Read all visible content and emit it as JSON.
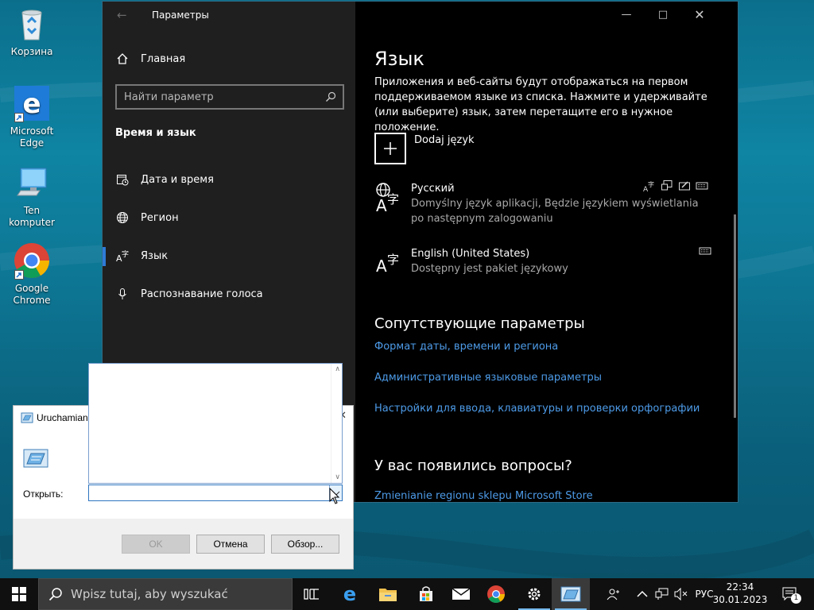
{
  "desktop": {
    "icons": [
      {
        "label": "Корзина",
        "icon": "recycle-bin-icon"
      },
      {
        "label": "Microsoft Edge",
        "icon": "edge-icon"
      },
      {
        "label": "Ten komputer",
        "icon": "computer-icon"
      },
      {
        "label": "Google Chrome",
        "icon": "chrome-icon"
      }
    ]
  },
  "settings": {
    "window_title": "Параметры",
    "home_label": "Главная",
    "search_placeholder": "Найти параметр",
    "section_title": "Время и язык",
    "nav": [
      {
        "label": "Дата и время",
        "icon": "calendar-clock-icon"
      },
      {
        "label": "Регион",
        "icon": "globe-icon"
      },
      {
        "label": "Язык",
        "icon": "language-icon",
        "active": true
      },
      {
        "label": "Распознавание голоса",
        "icon": "microphone-icon"
      }
    ],
    "page_title": "Язык",
    "description": "Приложения и веб-сайты будут отображаться на первом поддерживаемом языке из списка. Нажмите и удерживайте (или выберите) язык, затем перетащите его в нужное положение.",
    "add_language": "Dodaj język",
    "languages": [
      {
        "name": "Русский",
        "desc": "Domyślny język aplikacji, Będzie językiem wyświetlania po następnym zalogowaniu"
      },
      {
        "name": "English (United States)",
        "desc": "Dostępny jest pakiet językowy"
      }
    ],
    "related_title": "Сопутствующие параметры",
    "related_links": [
      "Формат даты, времени и региона",
      "Административные языковые параметры",
      "Настройки для ввода, клавиатуры и проверки орфографии"
    ],
    "questions_title": "У вас появились вопросы?",
    "questions_link": "Zmienianie regionu sklepu Microsoft Store"
  },
  "run_dialog": {
    "title": "Uruchamian",
    "open_label": "Открыть:",
    "input_value": "",
    "ok": "OK",
    "cancel": "Отмена",
    "browse": "Обзор..."
  },
  "taskbar": {
    "search_placeholder": "Wpisz tutaj, aby wyszukać",
    "language": "РУС",
    "time": "22:34",
    "date": "30.01.2023",
    "notification_count": "1",
    "accent": "#76b9ed"
  }
}
